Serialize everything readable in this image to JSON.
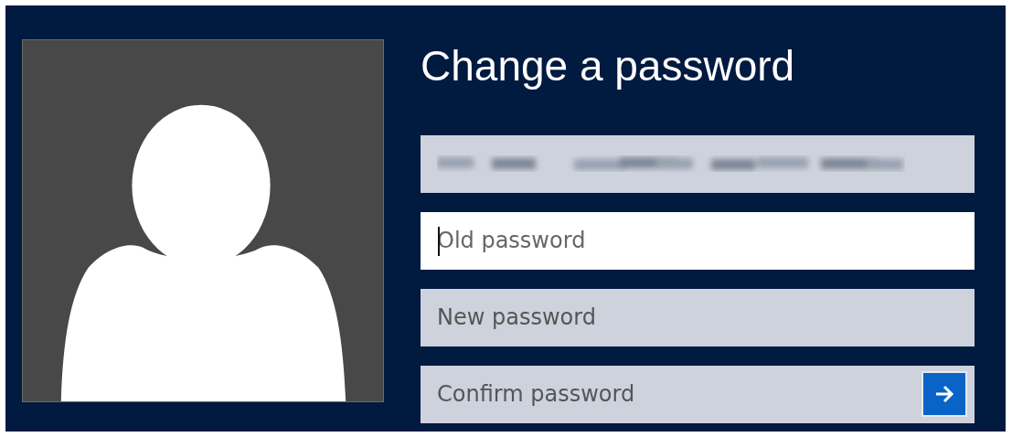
{
  "title": "Change a password",
  "fields": [
    {
      "kind": "blurred",
      "focused": false
    },
    {
      "kind": "input",
      "placeholder": "Old password",
      "focused": true
    },
    {
      "kind": "input",
      "placeholder": "New password",
      "focused": false
    },
    {
      "kind": "submit",
      "placeholder": "Confirm password",
      "focused": false
    }
  ]
}
